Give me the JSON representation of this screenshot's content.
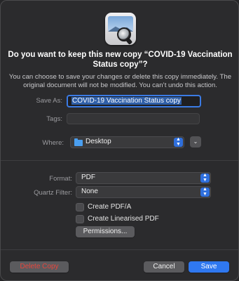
{
  "dialog": {
    "app_icon": "preview-app-icon",
    "title": "Do you want to keep this new copy “COVID-19 Vaccination Status copy”?",
    "subtitle": "You can choose to save your changes or delete this copy immediately. The original document will not be modified. You can’t undo this action."
  },
  "form": {
    "save_as_label": "Save As:",
    "save_as_value": "COVID-19 Vaccination Status copy",
    "tags_label": "Tags:",
    "tags_value": "",
    "where_label": "Where:",
    "where_value": "Desktop",
    "where_icon": "folder-icon"
  },
  "options": {
    "format_label": "Format:",
    "format_value": "PDF",
    "quartz_label": "Quartz Filter:",
    "quartz_value": "None",
    "create_pdfa_label": "Create PDF/A",
    "create_pdfa_checked": false,
    "create_linearised_label": "Create Linearised PDF",
    "create_linearised_checked": false,
    "permissions_label": "Permissions..."
  },
  "buttons": {
    "delete_label": "Delete Copy",
    "cancel_label": "Cancel",
    "save_label": "Save"
  },
  "colors": {
    "accent": "#2f78f0",
    "destructive": "#e8453c"
  }
}
